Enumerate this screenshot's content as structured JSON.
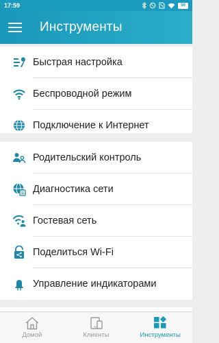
{
  "status_bar": {
    "time": "17:59",
    "battery": "56",
    "icons": [
      "bluetooth-icon",
      "muted-icon",
      "sim-icon",
      "wifi-icon",
      "battery-icon"
    ]
  },
  "app_bar": {
    "title": "Инструменты",
    "menu_icon": "hamburger-menu-icon"
  },
  "menu": {
    "group1": [
      {
        "label": "Быстрая настройка",
        "icon": "quick-setup-icon"
      },
      {
        "label": "Беспроводной режим",
        "icon": "wifi-icon"
      },
      {
        "label": "Подключение к Интернет",
        "icon": "globe-icon"
      }
    ],
    "group2": [
      {
        "label": "Родительский контроль",
        "icon": "parental-control-icon"
      },
      {
        "label": "Диагностика сети",
        "icon": "network-diagnostics-icon"
      },
      {
        "label": "Гостевая сеть",
        "icon": "guest-network-icon"
      },
      {
        "label": "Поделиться Wi-Fi",
        "icon": "share-wifi-icon"
      },
      {
        "label": "Управление индикаторами",
        "icon": "led-control-icon"
      }
    ]
  },
  "bottom_nav": {
    "items": [
      {
        "label": "Домой",
        "icon": "home-icon",
        "active": false
      },
      {
        "label": "Клиенты",
        "icon": "devices-icon",
        "active": false
      },
      {
        "label": "Инструменты",
        "icon": "tools-icon",
        "active": true
      }
    ]
  },
  "colors": {
    "accent": "#1a9bbd",
    "icon": "#1c87a8",
    "inactive": "#9a9a9a"
  }
}
